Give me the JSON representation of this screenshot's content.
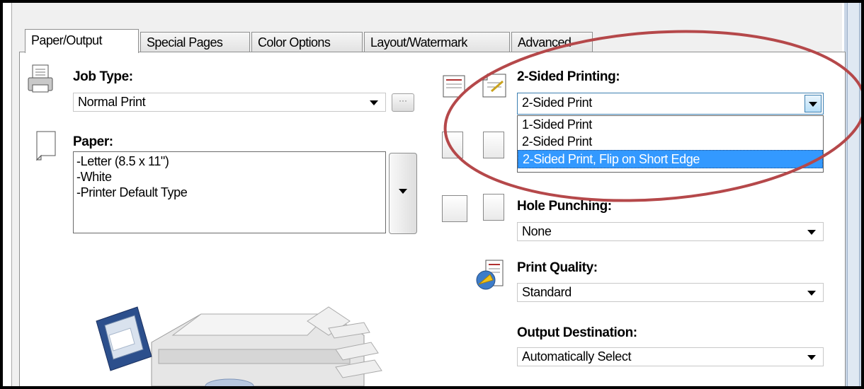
{
  "tabs": [
    {
      "label": "Paper/Output",
      "active": true
    },
    {
      "label": "Special Pages",
      "active": false
    },
    {
      "label": "Color Options",
      "active": false
    },
    {
      "label": "Layout/Watermark",
      "active": false
    },
    {
      "label": "Advanced",
      "active": false
    }
  ],
  "job_type": {
    "label": "Job Type:",
    "value": "Normal Print",
    "button_label": "···"
  },
  "paper": {
    "label": "Paper:",
    "lines": [
      "-Letter (8.5 x 11\")",
      "-White",
      "-Printer Default Type"
    ]
  },
  "two_sided": {
    "label": "2-Sided Printing:",
    "value": "2-Sided Print",
    "options": [
      "1-Sided Print",
      "2-Sided Print",
      "2-Sided Print, Flip on Short Edge"
    ],
    "highlighted": "2-Sided Print, Flip on Short Edge"
  },
  "hole_punching": {
    "label": "Hole Punching:",
    "value": "None"
  },
  "print_quality": {
    "label": "Print Quality:",
    "value": "Standard"
  },
  "output_destination": {
    "label": "Output Destination:",
    "value": "Automatically Select"
  },
  "colors": {
    "annotation_ellipse": "#b5484a",
    "selection": "#3399ff"
  }
}
